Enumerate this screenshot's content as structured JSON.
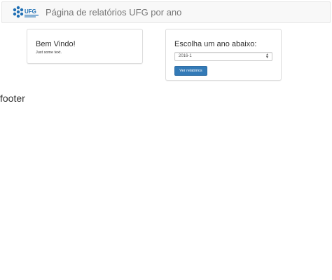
{
  "navbar": {
    "logo_text": "UFG",
    "title": "Página de relatórios UFG por ano"
  },
  "welcome_panel": {
    "heading": "Bem Vindo!",
    "text": "Just some text."
  },
  "year_panel": {
    "heading": "Escolha um ano abaixo:",
    "selected_year": "2016-1",
    "button_label": "Ver relatórios"
  },
  "footer": {
    "text": "footer"
  },
  "colors": {
    "primary_button": "#337ab7",
    "logo_blue": "#1f6fb4",
    "navbar_bg": "#f8f8f8"
  },
  "icons": {
    "logo": "ufg-logo",
    "select": "select-arrows-icon"
  }
}
